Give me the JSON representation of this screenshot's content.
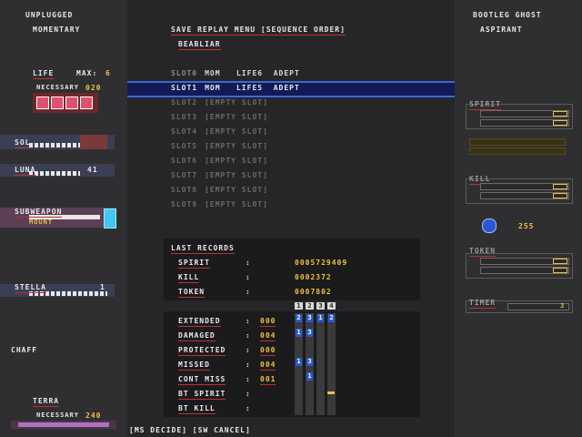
{
  "left": {
    "mode_line1": "UNPLUGGED",
    "mode_line2": "MOMENTARY",
    "life_label": "LIFE",
    "life_max_label": "MAX:",
    "life_max_value": "6",
    "necessary_label": "NECESSARY",
    "necessary_value": "020",
    "sol_label": "SOL",
    "luna_label": "LUNA",
    "luna_value": "41",
    "subweapon_label": "SUBWEAPON",
    "subweapon_name": "MOUNT",
    "stella_label": "STELLA",
    "stella_value": "1",
    "chaff_label": "CHAFF",
    "terra_label": "TERRA",
    "terra_necessary_label": "NECESSARY",
    "terra_necessary_value": "240"
  },
  "menu": {
    "title": "SAVE REPLAY MENU [SEQUENCE ORDER]",
    "subtitle": "BEABLIAR",
    "slots": [
      {
        "slot": "SLOT0",
        "text": "MOM   LIFE6  ADEPT",
        "state": "filled"
      },
      {
        "slot": "SLOT1",
        "text": "MOM   LIFE5  ADEPT",
        "state": "selected"
      },
      {
        "slot": "SLOT2",
        "text": "[EMPTY SLOT]",
        "state": "empty"
      },
      {
        "slot": "SLOT3",
        "text": "[EMPTY SLOT]",
        "state": "empty"
      },
      {
        "slot": "SLOT4",
        "text": "[EMPTY SLOT]",
        "state": "empty"
      },
      {
        "slot": "SLOT5",
        "text": "[EMPTY SLOT]",
        "state": "empty"
      },
      {
        "slot": "SLOT6",
        "text": "[EMPTY SLOT]",
        "state": "empty"
      },
      {
        "slot": "SLOT7",
        "text": "[EMPTY SLOT]",
        "state": "empty"
      },
      {
        "slot": "SLOT8",
        "text": "[EMPTY SLOT]",
        "state": "empty"
      },
      {
        "slot": "SLOT9",
        "text": "[EMPTY SLOT]",
        "state": "empty"
      }
    ],
    "footer": "[MS DECIDE] [SW CANCEL]"
  },
  "records": {
    "title": "LAST RECORDS",
    "spirit_label": "SPIRIT",
    "spirit_value": "0005729409",
    "kill_label": "KILL",
    "kill_value": "0002372",
    "token_label": "TOKEN",
    "token_value": "0007802"
  },
  "stats": {
    "grid_header": [
      "1",
      "2",
      "3",
      "4"
    ],
    "rows": [
      {
        "label": "EXTENDED",
        "value": "000",
        "marks": [
          "2",
          "3",
          "1",
          "2"
        ]
      },
      {
        "label": "DAMAGED",
        "value": "004",
        "marks": [
          "1",
          "3",
          "",
          ""
        ]
      },
      {
        "label": "PROTECTED",
        "value": "000",
        "marks": [
          "",
          "",
          "",
          ""
        ]
      },
      {
        "label": "MISSED",
        "value": "004",
        "marks": [
          "1",
          "3",
          "",
          ""
        ]
      },
      {
        "label": "CONT MISS",
        "value": "001",
        "marks": [
          "",
          "1",
          "",
          ""
        ]
      },
      {
        "label": "BT SPIRIT",
        "value": "",
        "marks": [
          "",
          "",
          "",
          ""
        ]
      },
      {
        "label": "BT KILL",
        "value": "",
        "marks": [
          "",
          "",
          "",
          ""
        ]
      }
    ]
  },
  "right": {
    "title_line1": "BOOTLEG GHOST",
    "title_line2": "ASPIRANT",
    "spirit_label": "SPIRIT",
    "kill_label": "KILL",
    "gem_value": "255",
    "token_label": "TOKEN",
    "timer_label": "TIMER",
    "timer_value": "3"
  },
  "colors": {
    "highlight": "#141a55",
    "highlight_border": "#3a6ad8",
    "accent_red": "#c03030",
    "number_yellow": "#f0c040",
    "empty_slot": "#6a6a6a"
  }
}
